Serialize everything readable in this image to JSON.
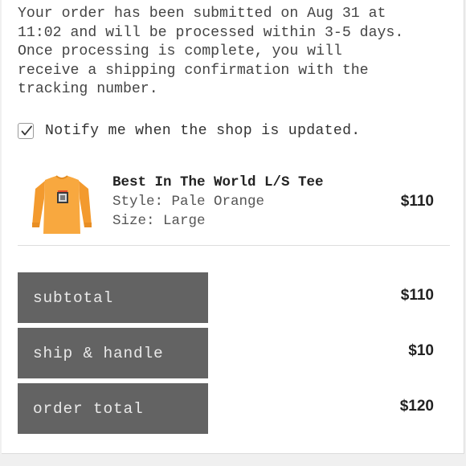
{
  "confirmation": {
    "message": "Your order has been submitted on Aug 31 at\n11:02 and will be processed within 3-5 days.\nOnce processing is complete, you will\nreceive a shipping confirmation with the\ntracking number."
  },
  "notify": {
    "checked": true,
    "label": "Notify me when the shop is updated."
  },
  "product": {
    "name": "Best In The World L/S Tee",
    "style": "Style: Pale Orange",
    "size": "Size: Large",
    "price": "$110",
    "image_icon": "orange-longsleeve-tee-image",
    "color": "#f7a23a"
  },
  "summary": {
    "subtotal_label": "subtotal",
    "subtotal_value": "$110",
    "shipping_label": "ship & handle",
    "shipping_value": "$10",
    "total_label": "order total",
    "total_value": "$120",
    "label_bg_color": "#636363"
  }
}
